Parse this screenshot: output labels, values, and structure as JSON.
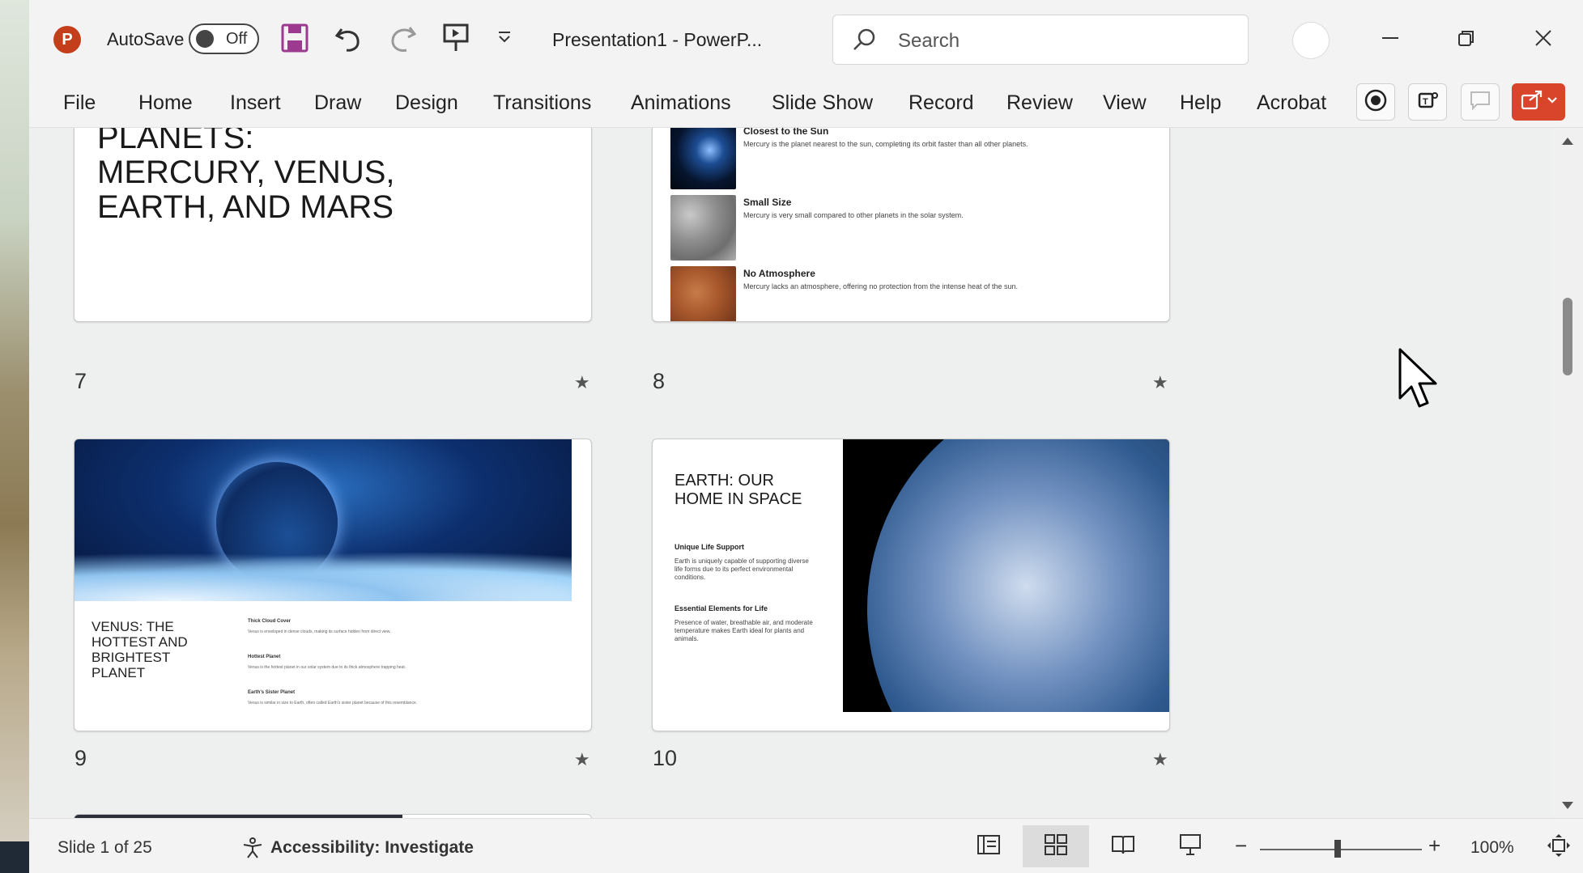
{
  "titlebar": {
    "app_logo_letter": "P",
    "autosave_label": "AutoSave",
    "autosave_state": "Off",
    "document_title": "Presentation1  -  PowerP...",
    "search_placeholder": "Search"
  },
  "ribbon": {
    "tabs": [
      "File",
      "Home",
      "Insert",
      "Draw",
      "Design",
      "Transitions",
      "Animations",
      "Slide Show",
      "Record",
      "Review",
      "View",
      "Help",
      "Acrobat"
    ]
  },
  "slides": {
    "s7": {
      "number": "7",
      "title": "PLANETS:\nMERCURY, VENUS,\nEARTH, AND MARS"
    },
    "s8": {
      "number": "8",
      "items": [
        {
          "heading": "Closest to the Sun",
          "text": "Mercury is the planet nearest to the sun, completing its orbit faster than all other planets."
        },
        {
          "heading": "Small Size",
          "text": "Mercury is very small compared to other planets in the solar system."
        },
        {
          "heading": "No Atmosphere",
          "text": "Mercury lacks an atmosphere, offering no protection from the intense heat of the sun."
        }
      ]
    },
    "s9": {
      "number": "9",
      "title": "VENUS: THE HOTTEST AND BRIGHTEST PLANET",
      "items": [
        {
          "heading": "Thick Cloud Cover",
          "text": "Venus is enveloped in dense clouds, making its surface hidden from direct view."
        },
        {
          "heading": "Hottest Planet",
          "text": "Venus is the hottest planet in our solar system due to its thick atmosphere trapping heat."
        },
        {
          "heading": "Earth's Sister Planet",
          "text": "Venus is similar in size to Earth, often called Earth's sister planet because of this resemblance."
        }
      ]
    },
    "s10": {
      "number": "10",
      "title": "EARTH: OUR HOME IN SPACE",
      "items": [
        {
          "heading": "Unique Life Support",
          "text": "Earth is uniquely capable of supporting diverse life forms due to its perfect environmental conditions."
        },
        {
          "heading": "Essential Elements for Life",
          "text": "Presence of water, breathable air, and moderate temperature makes Earth ideal for plants and animals."
        }
      ]
    }
  },
  "statusbar": {
    "slide_counter": "Slide 1 of 25",
    "accessibility": "Accessibility: Investigate",
    "zoom_minus": "−",
    "zoom_plus": "+",
    "zoom_level": "100%"
  },
  "colors": {
    "accent": "#c43e1c",
    "share_button": "#d9452b",
    "save_icon": "#9b3a8e"
  },
  "icons": [
    "powerpoint-logo-icon",
    "save-icon",
    "undo-icon",
    "redo-icon",
    "present-icon",
    "customize-toolbar-icon",
    "search-icon",
    "minimize-icon",
    "restore-icon",
    "close-icon",
    "record-icon",
    "teams-icon",
    "comments-icon",
    "share-icon",
    "star-icon",
    "accessibility-icon",
    "normal-view-icon",
    "slide-sorter-icon",
    "reading-view-icon",
    "slideshow-view-icon",
    "fit-slide-icon",
    "mouse-cursor-icon"
  ]
}
